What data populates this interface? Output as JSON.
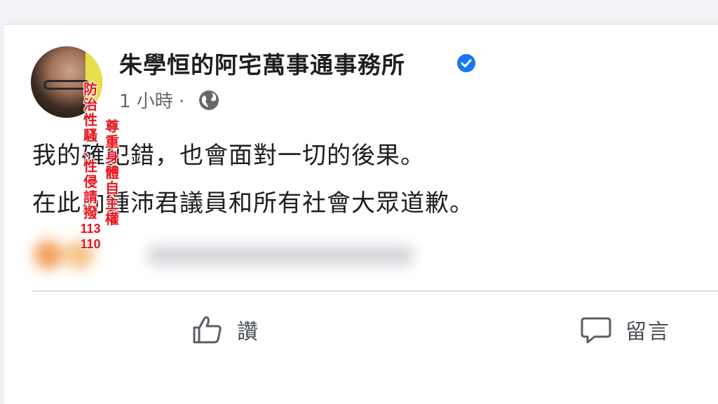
{
  "header": {
    "page_name": "朱學恒的阿宅萬事通事務所",
    "post_time": "1 小時 ·"
  },
  "post": {
    "line1": "我的確犯錯，也會面對一切的後果。",
    "line2": "在此向鍾沛君議員和所有社會大眾道歉。"
  },
  "actions": {
    "like_label": "讚",
    "comment_label": "留言"
  },
  "overlay": {
    "left_chars": [
      "防",
      "治",
      "性",
      "騷",
      "、",
      "性",
      "侵",
      "請",
      "撥",
      "113",
      "110"
    ],
    "right_chars": [
      "尊",
      "重",
      "身",
      "體",
      "自",
      "主",
      "權"
    ]
  },
  "icons": {
    "verified": "verified-badge-icon",
    "globe": "globe-icon",
    "like": "thumbs-up-icon",
    "comment": "comment-bubble-icon"
  },
  "colors": {
    "verified": "#1877f2",
    "overlay_text": "#e8141b",
    "secondary_text": "#65676b"
  }
}
